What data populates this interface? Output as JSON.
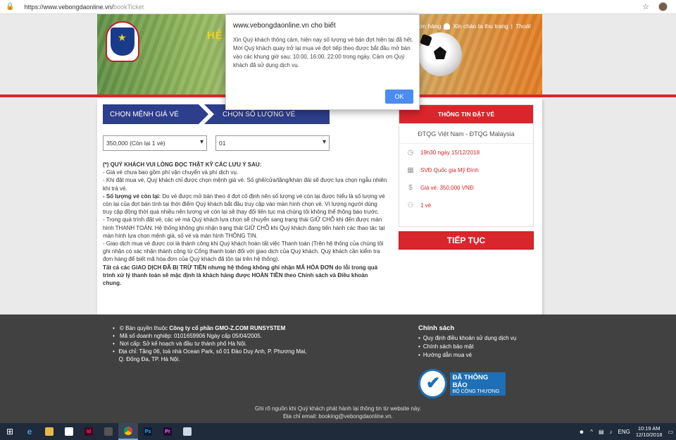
{
  "browser": {
    "url_host": "https://www.vebongdaonline.vn/",
    "url_path": "bookTicket"
  },
  "header": {
    "banner_title": "HỆ",
    "orders_label": "đơn hàng",
    "greeting": "Xin chào ta thu trang",
    "separator": "|",
    "logout": "Thoát"
  },
  "dialog": {
    "title": "www.vebongdaonline.vn cho biết",
    "message": "Xin Quý khách thông cảm, hiện nay số lượng vé bán đợt hiện tại đã hết. Mời Quý khách quay trở lại mua vé đợt tiếp theo được bắt đầu mở bán vào các khung giờ sau: 10:00, 16:00, 22:00 trong ngày. Cảm ơn Quý khách đã sử dụng dịch vụ.",
    "ok_label": "OK"
  },
  "steps": {
    "step1": "CHỌN MỆNH GIÁ VÉ",
    "step2": "CHỌN SỐ LƯỢNG VÉ"
  },
  "selects": {
    "price": "350,000 (Còn lại 1 vé)",
    "quantity": "01"
  },
  "notes": {
    "heading": "(*) QUÝ KHÁCH VUI LÒNG ĐỌC THẬT KỸ CÁC LƯU Ý SAU:",
    "p1": "- Giá vé chưa bao gồm phí vận chuyển và phí dịch vụ.",
    "p2": "- Khi đặt mua vé, Quý khách chỉ được chọn mệnh giá vé. Số ghế/cửa/tầng/khán đài sẽ được lựa chọn ngẫu nhiên khi trả vé.",
    "p3_label": "- Số lượng vé còn lại:",
    "p3": " Do vé được mở bán theo 4 đợt cố định nên số lượng vé còn lại được hiểu là số lượng vé còn lại của đợt bán tính tại thời điểm Quý khách bắt đầu truy cập vào màn hình chọn vé. Vì lượng người dùng truy cập đồng thời quá nhiều nên lượng vé còn lại sẽ thay đổi liên tục mà chúng tôi không thể thông báo trước.",
    "p4": "- Trong quá trình đặt vé, các vé mà Quý khách lựa chọn sẽ chuyển sang trạng thái GIỮ CHỖ khi đến được màn hình THANH TOÁN. Hệ thống không ghi nhận trạng thái GIỮ CHỖ khi Quý khách đang tiến hành các thao tác tại màn hình lựa chọn mệnh giá, số vé và màn hình THÔNG TIN.",
    "p5": "- Giao dịch mua vé được coi là thành công khi Quý khách hoàn tất việc Thanh toán (Trên hệ thống của chúng tôi ghi nhận có xác nhận thành công từ Cổng thanh toán đối với giao dịch của Quý khách. Quý khách cần kiểm tra đơn hàng để biết mã hóa đơn của Quý khách đã tồn tại trên hệ thống).",
    "p6": "Tất cả các GIAO DỊCH ĐÃ BỊ TRỪ TIỀN nhưng hệ thống không ghi nhận MÃ HÓA ĐƠN do lỗi trong quá trình xử lý thanh toán sẽ mặc định là khách hàng được HOÀN TIỀN theo Chính sách và Điều khoản chung."
  },
  "info": {
    "heading": "THÔNG TIN ĐẶT VÉ",
    "match": "ĐTQG Việt Nam - ĐTQG Malaysia",
    "time": "19h30 ngày 15/12/2018",
    "venue": "SVĐ Quốc gia Mỹ Đình",
    "price": "Giá vé: 350,000 VNĐ",
    "count": "1 vé",
    "continue_label": "TIẾP TỤC"
  },
  "footer": {
    "copyright_prefix": "© Bản quyền thuộc ",
    "company": "Công ty cổ phần GMO-Z.COM RUNSYSTEM",
    "tax": "Mã số doanh nghiệp: 0101659906 Ngày cấp 05/04/2005.",
    "issued": "Nơi cấp: Sở kế hoạch và đầu tư thành phố Hà Nội.",
    "address": "Địa chỉ: Tầng 06, toà nhà Ocean Park, số 01 Đào Duy Anh, P. Phương Mai, Q. Đống Đa, TP. Hà Nội.",
    "policy_heading": "Chính sách",
    "policy_links": [
      "Quy định điều khoản sử dụng dịch vụ",
      "Chính sách bảo mật",
      "Hướng dẫn mua vé"
    ],
    "badge_line1": "ĐÃ THÔNG BÁO",
    "badge_line2": "BỘ CÔNG THƯƠNG",
    "bottom1": "Ghi rõ nguồn khi Quý khách phát hành lại thông tin từ website này.",
    "bottom2": "Địa chỉ email: booking@vebongdaonline.vn."
  },
  "taskbar": {
    "lang": "ENG",
    "time": "10:19 AM",
    "date": "12/10/2018"
  }
}
